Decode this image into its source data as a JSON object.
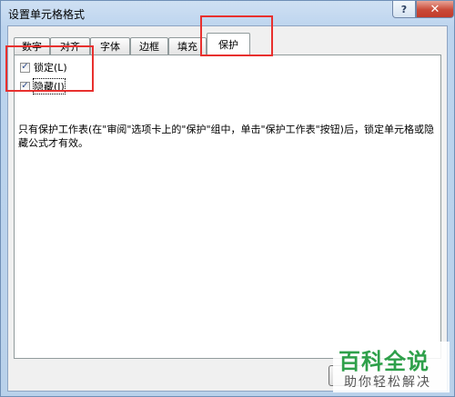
{
  "window": {
    "title": "设置单元格格式"
  },
  "titlebar": {
    "help_glyph": "?",
    "close_glyph": "✕"
  },
  "tabs": [
    {
      "label": "数字"
    },
    {
      "label": "对齐"
    },
    {
      "label": "字体"
    },
    {
      "label": "边框"
    },
    {
      "label": "填充"
    },
    {
      "label": "保护",
      "active": true
    }
  ],
  "protection": {
    "locked": {
      "label": "锁定(L)",
      "checked": true
    },
    "hidden": {
      "label": "隐藏(I)",
      "checked": true
    },
    "description": "只有保护工作表(在\"审阅\"选项卡上的\"保护\"组中，单击\"保护工作表\"按钮)后，锁定单元格或隐藏公式才有效。"
  },
  "watermark": {
    "logo": "百科全说",
    "subtitle": "助你轻松解决"
  },
  "colors": {
    "highlight": "#e8302e",
    "watermark_green": "#2ea04a"
  }
}
